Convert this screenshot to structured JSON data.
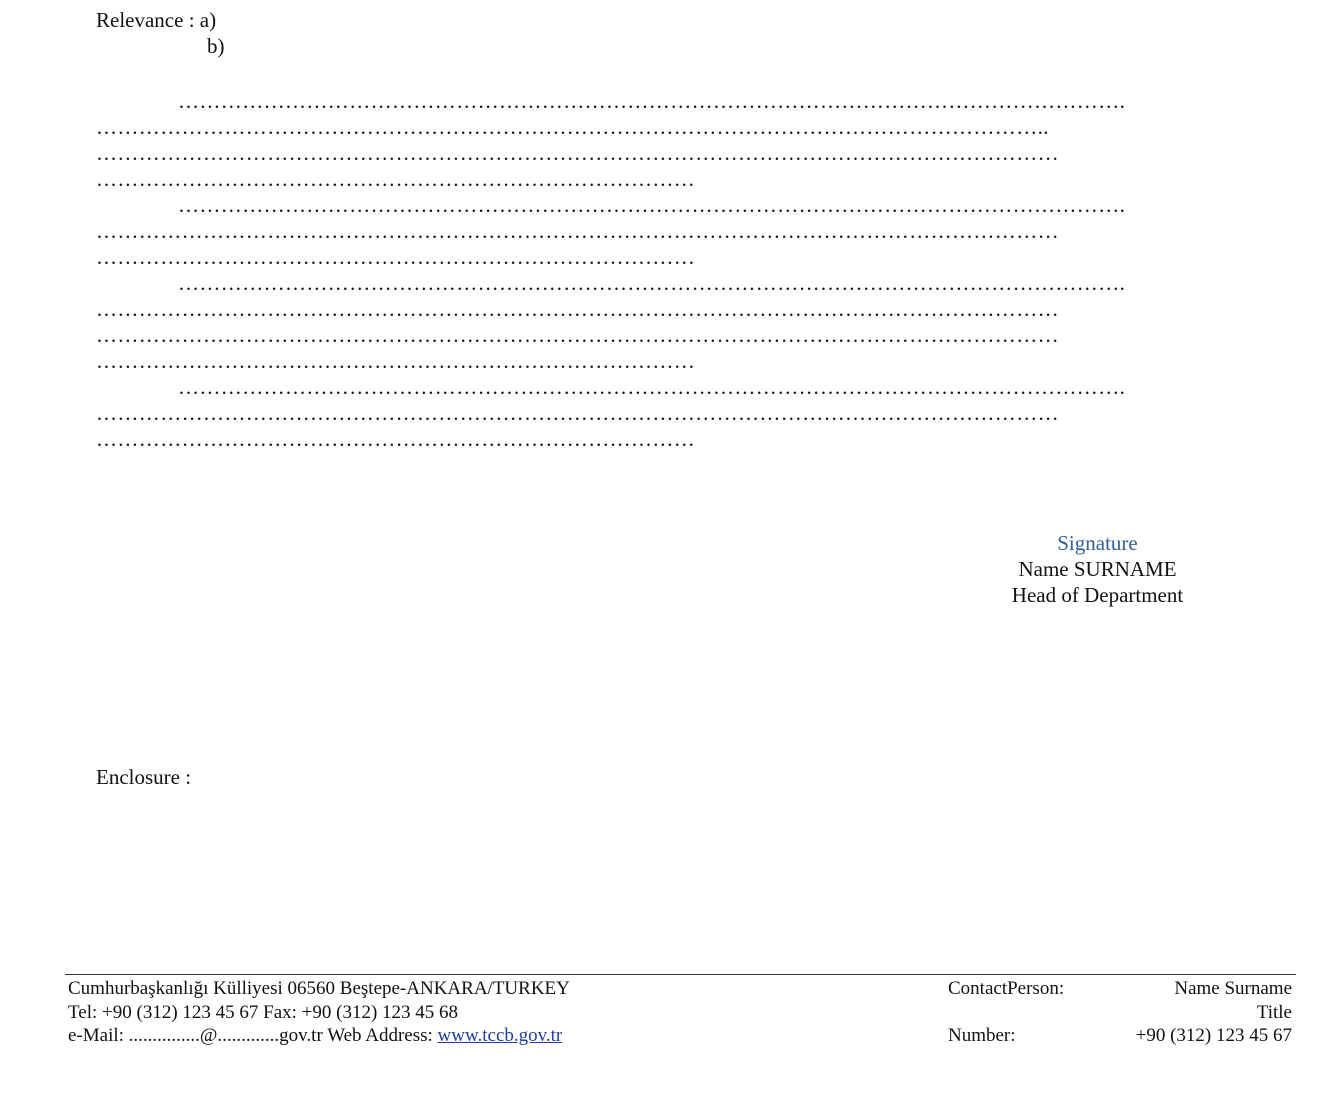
{
  "relevance": {
    "label": "Relevance : a)",
    "b": "b)"
  },
  "paragraphs": [
    {
      "lines": [
        "…………………………………………………………………………………………………………………….",
        "……………………………………………………………………………………………………………………..",
        "………………………………………………………………………………………………………………………",
        "…………………………………………………………………………"
      ]
    },
    {
      "lines": [
        "…………………………………………………………………………………………………………………….",
        "………………………………………………………………………………………………………………………",
        "…………………………………………………………………………"
      ]
    },
    {
      "lines": [
        "…………………………………………………………………………………………………………………….",
        "………………………………………………………………………………………………………………………",
        "………………………………………………………………………………………………………………………",
        "…………………………………………………………………………"
      ]
    },
    {
      "lines": [
        "…………………………………………………………………………………………………………………….",
        "………………………………………………………………………………………………………………………",
        "…………………………………………………………………………"
      ]
    }
  ],
  "signature": {
    "label": "Signature",
    "name": "Name SURNAME",
    "title": "Head of Department"
  },
  "enclosure": {
    "label": "Enclosure :"
  },
  "footer": {
    "address": "Cumhurbaşkanlığı Külliyesi 06560 Beştepe-ANKARA/TURKEY",
    "tel_fax": "Tel: +90 (312) 123 45 67  Fax: +90 (312) 123 45 68",
    "email_prefix": "e-Mail: ...............@.............gov.tr Web Address: ",
    "web_link": "www.tccb.gov.tr",
    "contact_label": "ContactPerson:",
    "contact_name": "Name Surname",
    "contact_title": "Title",
    "number_label": "Number:",
    "number_value": "+90 (312) 123 45 67"
  },
  "colors": {
    "signature_link": "#2d5f9a",
    "footer_link": "#1f3f99"
  }
}
